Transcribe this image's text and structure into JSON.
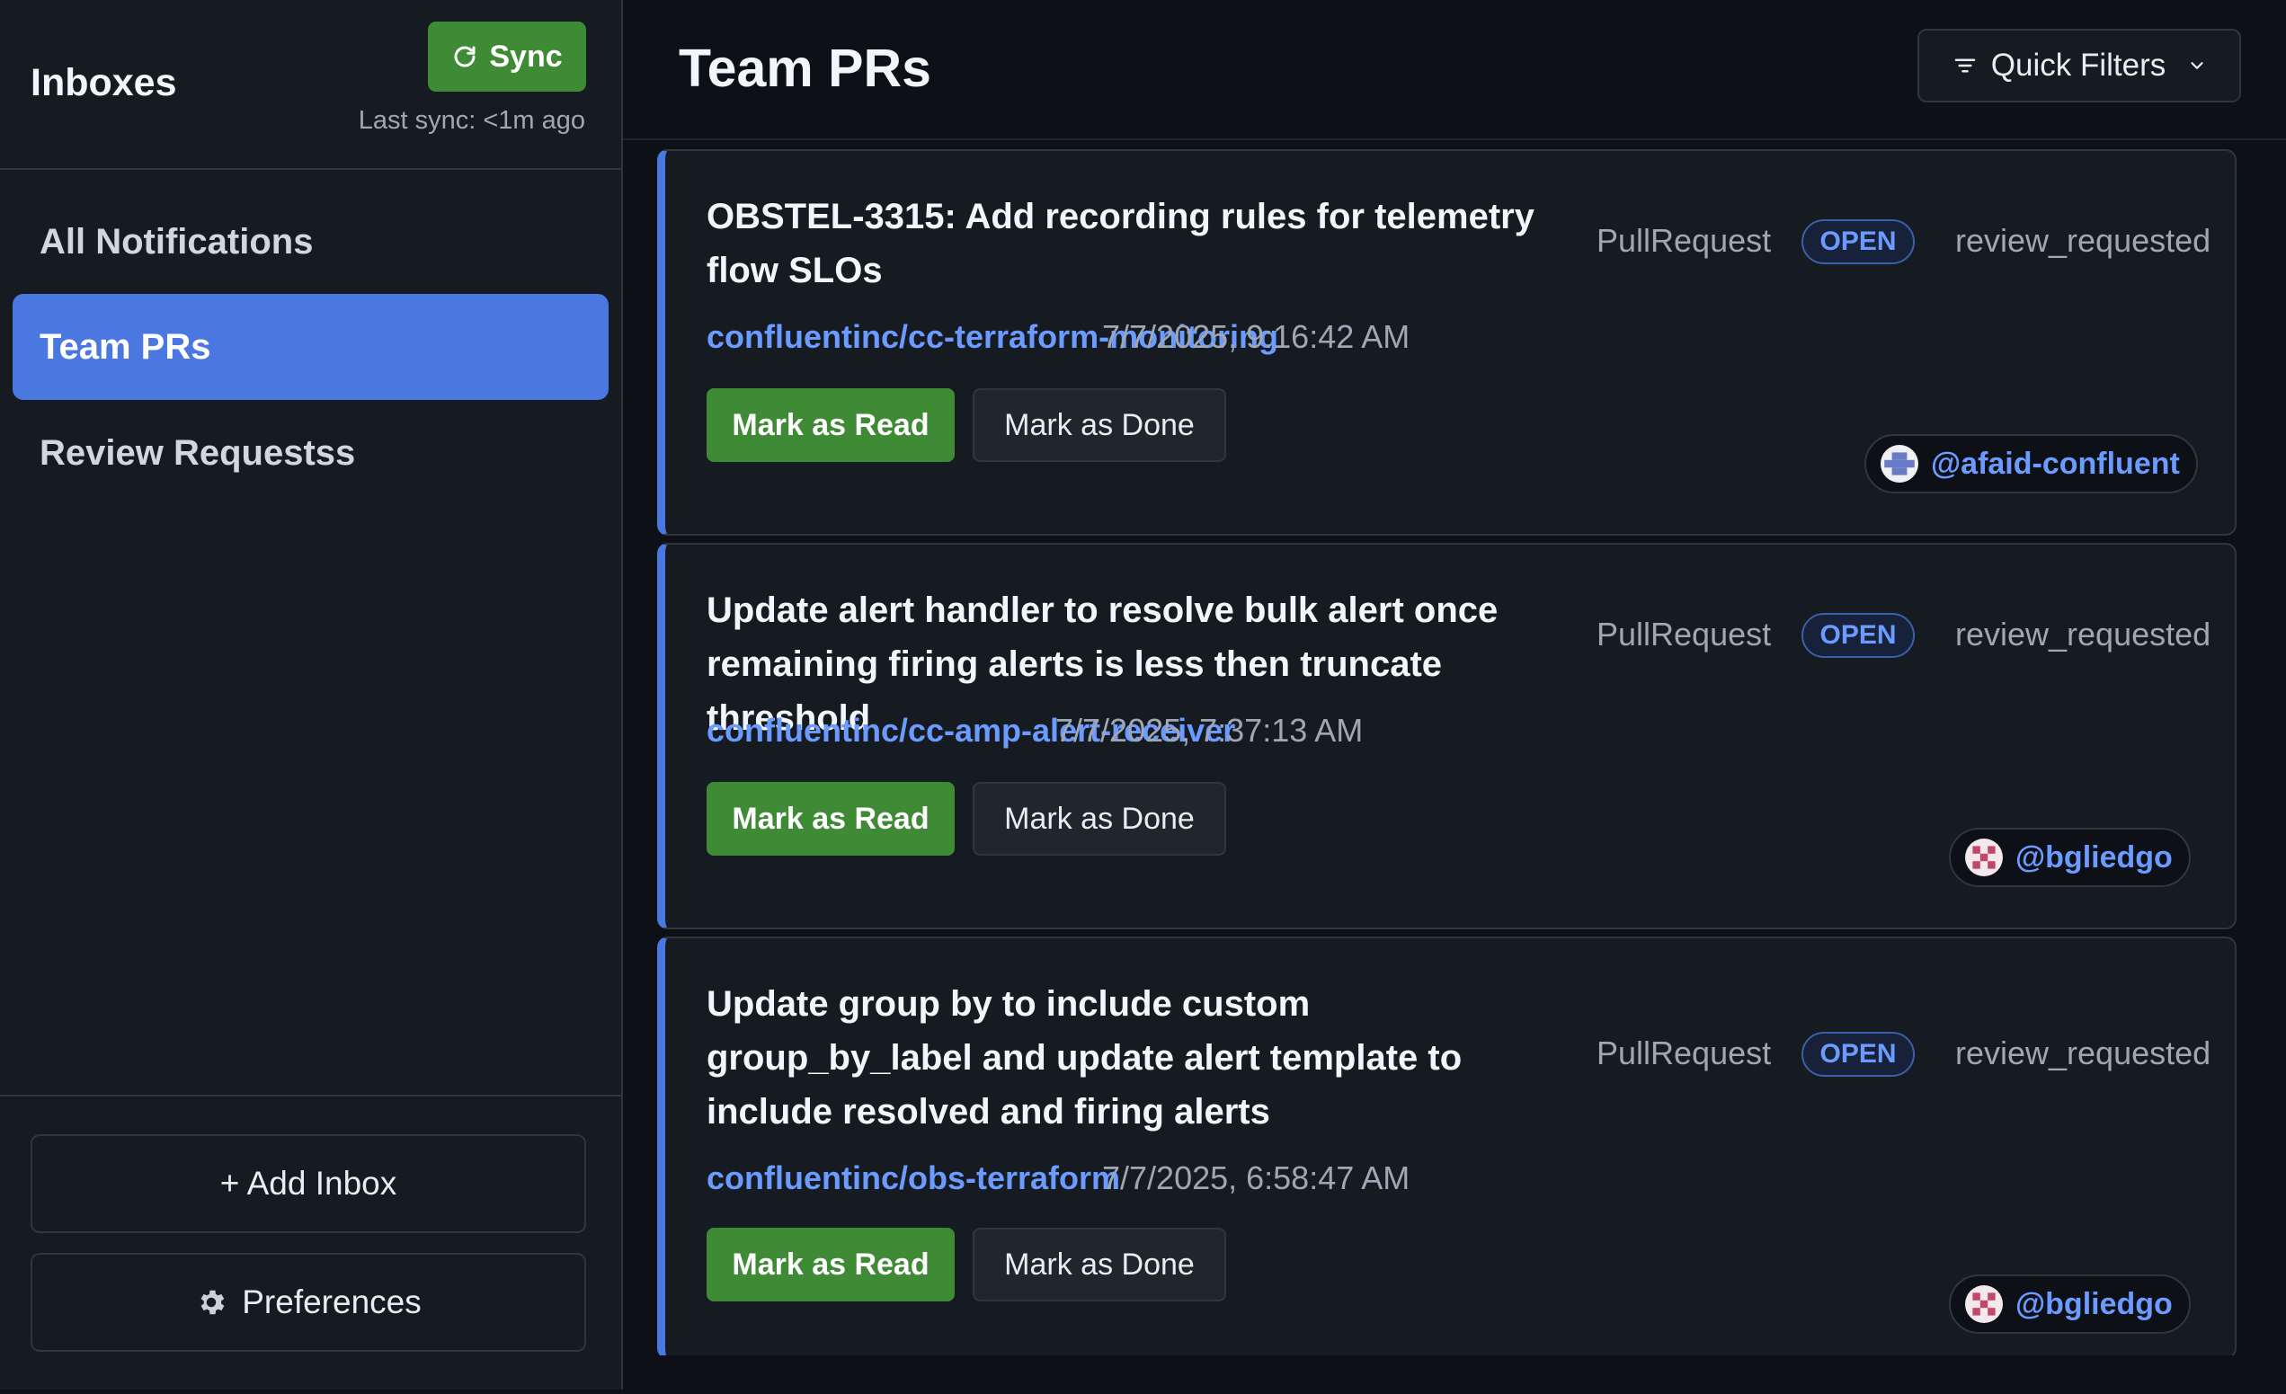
{
  "sidebar": {
    "title": "Inboxes",
    "sync_label": "Sync",
    "last_sync": "Last sync: <1m ago",
    "items": [
      {
        "label": "All Notifications"
      },
      {
        "label": "Team PRs"
      },
      {
        "label": "Review Requestss"
      }
    ],
    "add_inbox": "+ Add Inbox",
    "preferences": "Preferences"
  },
  "main": {
    "title": "Team PRs",
    "quick_filters": "Quick Filters"
  },
  "notifications": [
    {
      "title": "OBSTEL-3315: Add recording rules for telemetry flow SLOs",
      "type": "PullRequest",
      "state": "OPEN",
      "reason": "review_requested",
      "repo": "confluentinc/cc-terraform-monitoring",
      "time": "7/7/2025, 9:16:42 AM",
      "mark_read": "Mark as Read",
      "mark_done": "Mark as Done",
      "author": "@afaid-confluent"
    },
    {
      "title": "Update alert handler to resolve bulk alert once remaining firing alerts is less then truncate threshold",
      "type": "PullRequest",
      "state": "OPEN",
      "reason": "review_requested",
      "repo": "confluentinc/cc-amp-alert-receiver",
      "time": "7/7/2025, 7:37:13 AM",
      "mark_read": "Mark as Read",
      "mark_done": "Mark as Done",
      "author": "@bgliedgo"
    },
    {
      "title": "Update group by to include custom group_by_label and update alert template to include resolved and firing alerts",
      "type": "PullRequest",
      "state": "OPEN",
      "reason": "review_requested",
      "repo": "confluentinc/obs-terraform",
      "time": "7/7/2025, 6:58:47 AM",
      "mark_read": "Mark as Read",
      "mark_done": "Mark as Done",
      "author": "@bgliedgo"
    }
  ],
  "colors": {
    "accent": "#4a78e0",
    "success": "#3f8a34",
    "link": "#6b9bff",
    "background": "#0d1117",
    "panel": "#161b22"
  },
  "icons": {
    "sync": "refresh-icon",
    "quick_filters": "filter-icon",
    "dropdown": "chevron-down-icon",
    "preferences": "gear-icon"
  }
}
